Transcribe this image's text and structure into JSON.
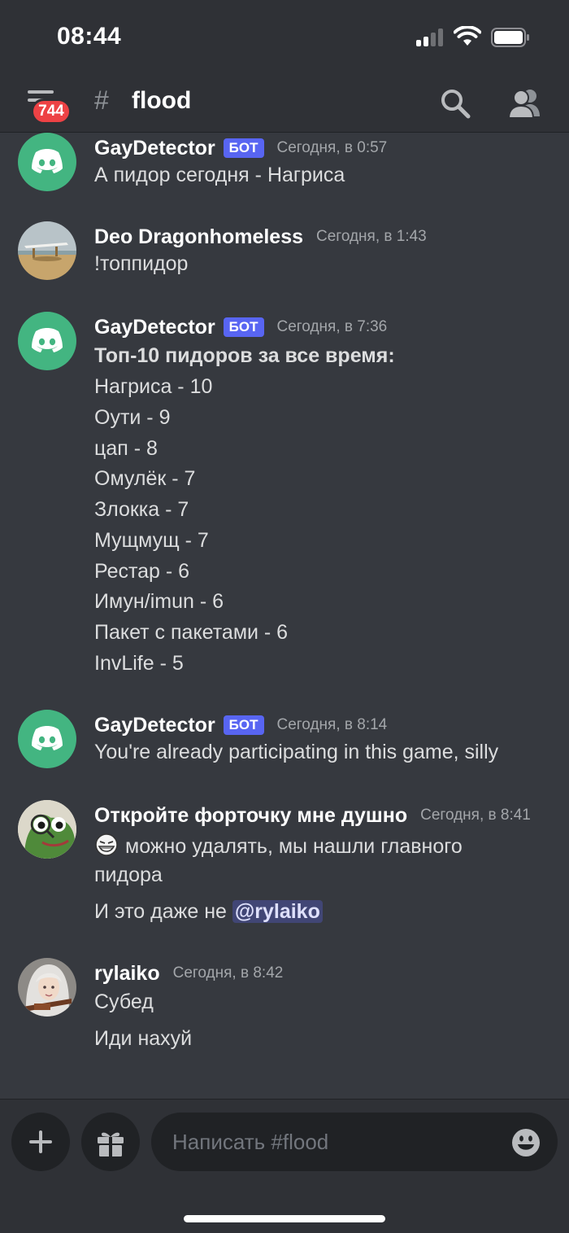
{
  "status_bar": {
    "time": "08:44",
    "icons": [
      "cellular-signal-icon",
      "wifi-icon",
      "battery-icon"
    ]
  },
  "header": {
    "unread_badge": "744",
    "channel_hash": "#",
    "channel_name": "flood",
    "icons": [
      "hamburger-menu-icon",
      "hash-icon",
      "search-icon",
      "members-icon"
    ]
  },
  "messages": [
    {
      "author": "GayDetector",
      "bot_tag": "БОТ",
      "timestamp": "Сегодня, в 0:57",
      "avatar": "discord-logo-avatar",
      "lines": [
        "А пидор сегодня - Нагриса"
      ]
    },
    {
      "author": "Deo Dragonhomeless",
      "timestamp": "Сегодня, в 1:43",
      "avatar": "beach-photo-avatar",
      "lines": [
        "!топпидор"
      ]
    },
    {
      "author": "GayDetector",
      "bot_tag": "БОТ",
      "timestamp": "Сегодня, в 7:36",
      "avatar": "discord-logo-avatar",
      "title": "Топ-10 пидоров за все время:",
      "lines": [
        "Нагриса - 10",
        "Оути - 9",
        "цап - 8",
        "Омулёк - 7",
        "Злокка - 7",
        "Мущмущ - 7",
        "Рестар - 6",
        "Имун/imun - 6",
        "Пакет с пакетами - 6",
        "InvLife - 5"
      ]
    },
    {
      "author": "GayDetector",
      "bot_tag": "БОТ",
      "timestamp": "Сегодня, в 8:14",
      "avatar": "discord-logo-avatar",
      "lines": [
        "You're already participating in this game, silly"
      ]
    },
    {
      "author": "Откройте форточку мне душно",
      "timestamp": "Сегодня, в 8:41",
      "avatar": "pepe-frog-avatar",
      "emoji": "troll-face-emoji",
      "lines": [
        "можно удалять, мы нашли главного",
        "пидора"
      ],
      "followup": "И это даже не",
      "mention": "@rylaiko"
    },
    {
      "author": "rylaiko",
      "timestamp": "Сегодня, в 8:42",
      "avatar": "anime-girl-avatar",
      "lines": [
        "Субед",
        "Иди нахуй"
      ]
    }
  ],
  "composer": {
    "placeholder": "Написать #flood",
    "icons": [
      "plus-icon",
      "gift-icon",
      "emoji-icon"
    ]
  },
  "colors": {
    "background": "#36393f",
    "header": "#2f3136",
    "bot_tag": "#5865f2",
    "badge": "#ed4245",
    "discord_avatar": "#43b581",
    "mention_bg": "#414675"
  }
}
